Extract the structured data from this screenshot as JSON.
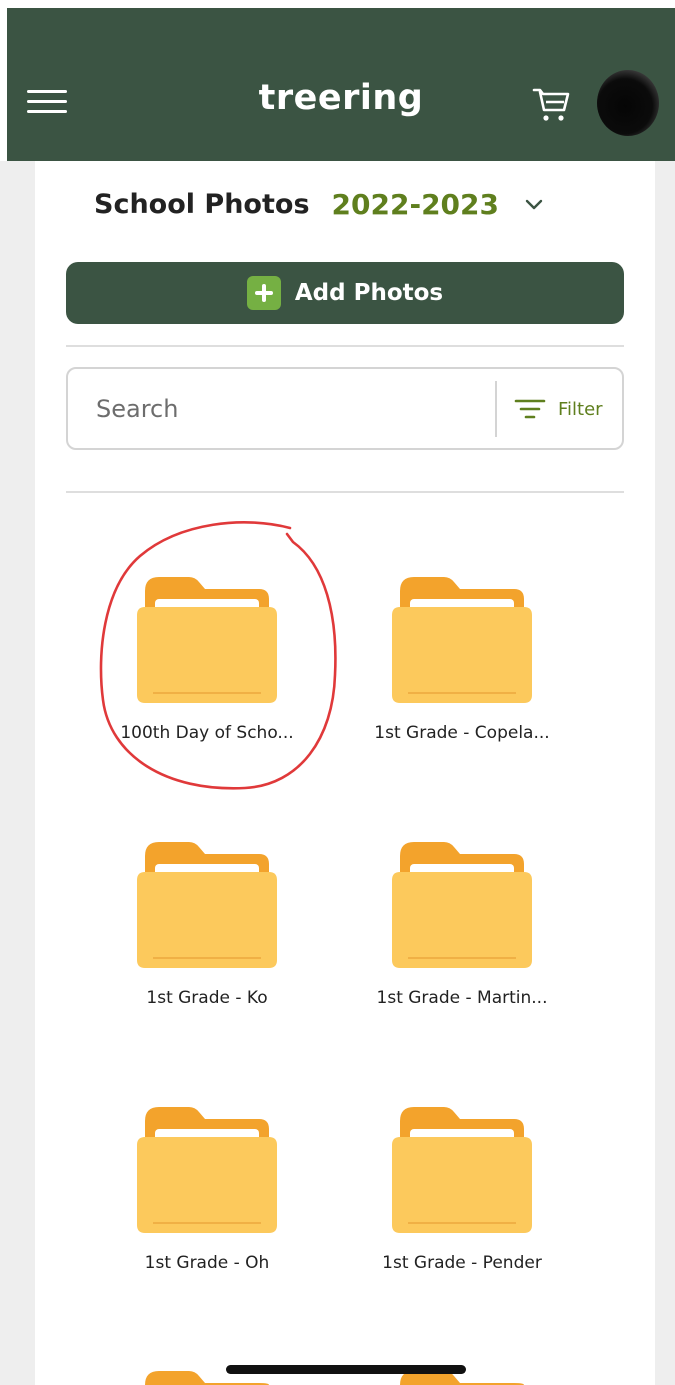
{
  "header": {
    "logo_text": "treering",
    "background_color": "#3b5443",
    "menu_icon": "hamburger-menu-icon",
    "cart_icon": "shopping-cart-icon",
    "avatar": "user-avatar"
  },
  "page": {
    "title": "School Photos",
    "year": "2022-2023",
    "year_color": "#5f7f1e",
    "year_dropdown_icon": "chevron-down-icon"
  },
  "actions": {
    "add_photos_label": "Add Photos",
    "add_icon": "plus-square-icon",
    "accent_color": "#75b043"
  },
  "search": {
    "placeholder": "Search",
    "value": "",
    "filter_label": "Filter",
    "filter_icon": "filter-lines-icon"
  },
  "folders": [
    {
      "name": "100th Day of Scho...",
      "annotated": true
    },
    {
      "name": "1st Grade - Copela..."
    },
    {
      "name": "1st Grade - Ko"
    },
    {
      "name": "1st Grade - Martin..."
    },
    {
      "name": "1st Grade - Oh"
    },
    {
      "name": "1st Grade - Pender"
    }
  ],
  "folder_icon": "folder-icon",
  "folder_colors": {
    "body": "#fcc95c",
    "tab": "#f3a32c",
    "paper": "#ffffff"
  }
}
